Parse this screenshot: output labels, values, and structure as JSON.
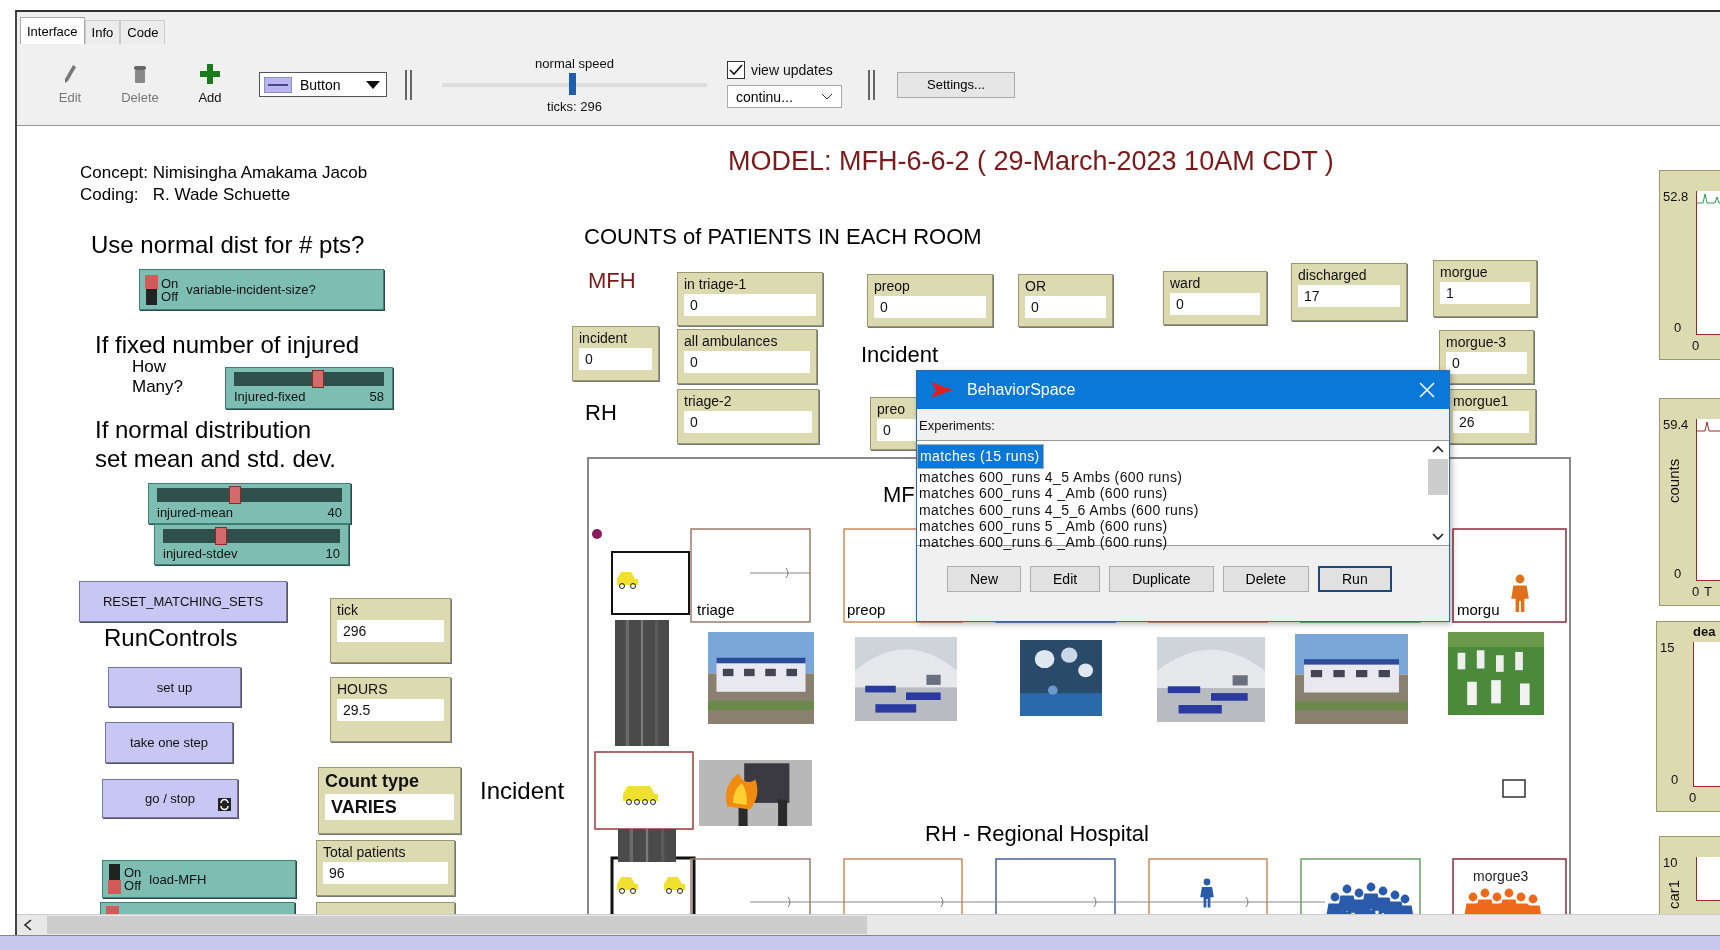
{
  "tabs": [
    {
      "label": "Interface",
      "selected": true
    },
    {
      "label": "Info",
      "selected": false
    },
    {
      "label": "Code",
      "selected": false
    }
  ],
  "toolbar": {
    "tools": [
      {
        "kind": "edit",
        "label": "Edit",
        "disabled": true
      },
      {
        "kind": "delete",
        "label": "Delete",
        "disabled": true
      },
      {
        "kind": "add",
        "label": "Add",
        "disabled": false
      }
    ],
    "widget_menu": "Button",
    "speed_label": "normal speed",
    "speed": {
      "level": 0.49
    },
    "ticks": "ticks: 296",
    "view_updates": {
      "label": "view updates",
      "checked": true
    },
    "update_mode": "continu...",
    "settings_button": "Settings..."
  },
  "widgets": [
    {
      "kind": "note",
      "text": "Concept: Nimisingha Amakama Jacob",
      "color": "#000000"
    },
    {
      "kind": "note",
      "text": "Coding:   R. Wade Schuette",
      "color": "#000000"
    },
    {
      "kind": "note",
      "text": "MODEL: MFH-6-6-2 ( 29-March-2023 10AM CDT )",
      "color": "#7a1a1a"
    },
    {
      "kind": "note",
      "text": "Use normal dist for # pts?",
      "color": "#000000"
    },
    {
      "kind": "switch",
      "label": "variable-incident-size?",
      "on_label": "On",
      "off_label": "Off",
      "on": true
    },
    {
      "kind": "note",
      "text": "If fixed number of injured",
      "color": "#000000"
    },
    {
      "kind": "note",
      "text": "How Many?",
      "color": "#000000"
    },
    {
      "kind": "slider",
      "label": "Injured-fixed",
      "value": "58",
      "level": 0.56
    },
    {
      "kind": "note",
      "text": "If normal distribution",
      "color": "#000000"
    },
    {
      "kind": "note",
      "text": "set mean and std. dev.",
      "color": "#000000"
    },
    {
      "kind": "slider",
      "label": "injured-mean",
      "value": "40",
      "level": 0.42
    },
    {
      "kind": "slider",
      "label": "injured-stdev",
      "value": "10",
      "level": 0.33
    },
    {
      "kind": "button",
      "label": "RESET_MATCHING_SETS",
      "forever": false
    },
    {
      "kind": "note",
      "text": "RunControls",
      "color": "#000000"
    },
    {
      "kind": "button",
      "label": "set up",
      "forever": false
    },
    {
      "kind": "button",
      "label": "take one step",
      "forever": false
    },
    {
      "kind": "button",
      "label": "go / stop",
      "forever": true
    },
    {
      "kind": "switch",
      "label": "load-MFH",
      "on_label": "On",
      "off_label": "Off",
      "on": false
    },
    {
      "kind": "switch",
      "on": true
    },
    {
      "kind": "monitor",
      "label": "tick",
      "value": "296"
    },
    {
      "kind": "monitor",
      "label": "HOURS",
      "value": "29.5"
    },
    {
      "kind": "monitor-large",
      "label": "Count type",
      "value": "VARIES"
    },
    {
      "kind": "monitor",
      "label": "Total patients",
      "value": "96"
    },
    {
      "kind": "monitor"
    },
    {
      "kind": "note",
      "text": "Incident",
      "color": "#000000"
    },
    {
      "kind": "note",
      "text": "COUNTS of PATIENTS IN EACH ROOM",
      "color": "#000000"
    },
    {
      "kind": "note",
      "text": "MFH",
      "color": "#7a1a1a"
    },
    {
      "kind": "note",
      "text": "Incident",
      "color": "#000000"
    },
    {
      "kind": "note",
      "text": "RH",
      "color": "#000000"
    },
    {
      "kind": "monitor",
      "label": "in triage-1",
      "value": "0"
    },
    {
      "kind": "monitor",
      "label": "preop",
      "value": "0"
    },
    {
      "kind": "monitor",
      "label": "OR",
      "value": "0"
    },
    {
      "kind": "monitor",
      "label": "ward",
      "value": "0"
    },
    {
      "kind": "monitor",
      "label": "discharged",
      "value": "17"
    },
    {
      "kind": "monitor",
      "label": "morgue",
      "value": "1"
    },
    {
      "kind": "monitor",
      "label": "incident",
      "value": "0"
    },
    {
      "kind": "monitor",
      "label": "all ambulances",
      "value": "0"
    },
    {
      "kind": "monitor",
      "label": "morgue-3",
      "value": "0"
    },
    {
      "kind": "monitor",
      "label": "triage-2",
      "value": "0"
    },
    {
      "kind": "monitor",
      "label": "preo",
      "value": "0"
    },
    {
      "kind": "monitor",
      "label": "morgue1",
      "value": "26"
    }
  ],
  "view": {
    "label": "MF",
    "rooms": [
      "triage",
      "preop",
      "morgu"
    ],
    "section_title": "RH - Regional Hospital",
    "agent_label": "morgue3"
  },
  "plots": [
    {
      "y_max": "52.8",
      "y_min": "0",
      "x_min": "0"
    },
    {
      "y_label": "counts",
      "y_max": "59.4",
      "y_min": "0",
      "x_min": "0",
      "x_label": "T"
    },
    {
      "title": "dea",
      "y_max": "15",
      "y_min": "0",
      "x_min": "0"
    },
    {
      "y_label": "car1",
      "y_max": "10"
    }
  ],
  "dialog": {
    "title": "BehaviorSpace",
    "label": "Experiments:",
    "experiments": [
      {
        "name": "matches (15 runs)",
        "selected": true
      },
      {
        "name": "matches 600_runs 4_5 Ambs (600 runs)",
        "selected": false
      },
      {
        "name": "matches 600_runs 4 _Amb (600 runs)",
        "selected": false
      },
      {
        "name": "matches 600_runs 4_5_6 Ambs (600 runs)",
        "selected": false
      },
      {
        "name": "matches 600_runs 5 _Amb (600 runs)",
        "selected": false
      },
      {
        "name": "matches 600_runs 6 _Amb (600 runs)",
        "selected": false
      }
    ],
    "buttons": [
      {
        "label": "New",
        "default": false
      },
      {
        "label": "Edit",
        "default": false
      },
      {
        "label": "Duplicate",
        "default": false
      },
      {
        "label": "Delete",
        "default": false
      },
      {
        "label": "Run",
        "default": true
      }
    ]
  }
}
